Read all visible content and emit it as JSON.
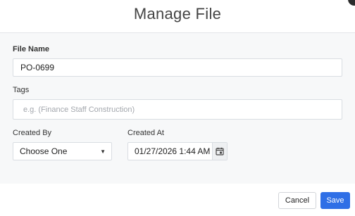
{
  "dialog": {
    "title": "Manage File"
  },
  "form": {
    "file_name": {
      "label": "File Name",
      "value": "PO-0699"
    },
    "tags": {
      "label": "Tags",
      "placeholder": "e.g. (Finance Staff Construction)"
    },
    "created_by": {
      "label": "Created By",
      "selected": "Choose One"
    },
    "created_at": {
      "label": "Created At",
      "value": "01/27/2026 1:44 AM"
    }
  },
  "footer": {
    "cancel_label": "Cancel",
    "save_label": "Save"
  },
  "colors": {
    "primary": "#2f6fe6",
    "body_background": "#f7f8f9"
  },
  "icons": {
    "caret": "caret-down-icon",
    "calendar": "calendar-icon"
  }
}
